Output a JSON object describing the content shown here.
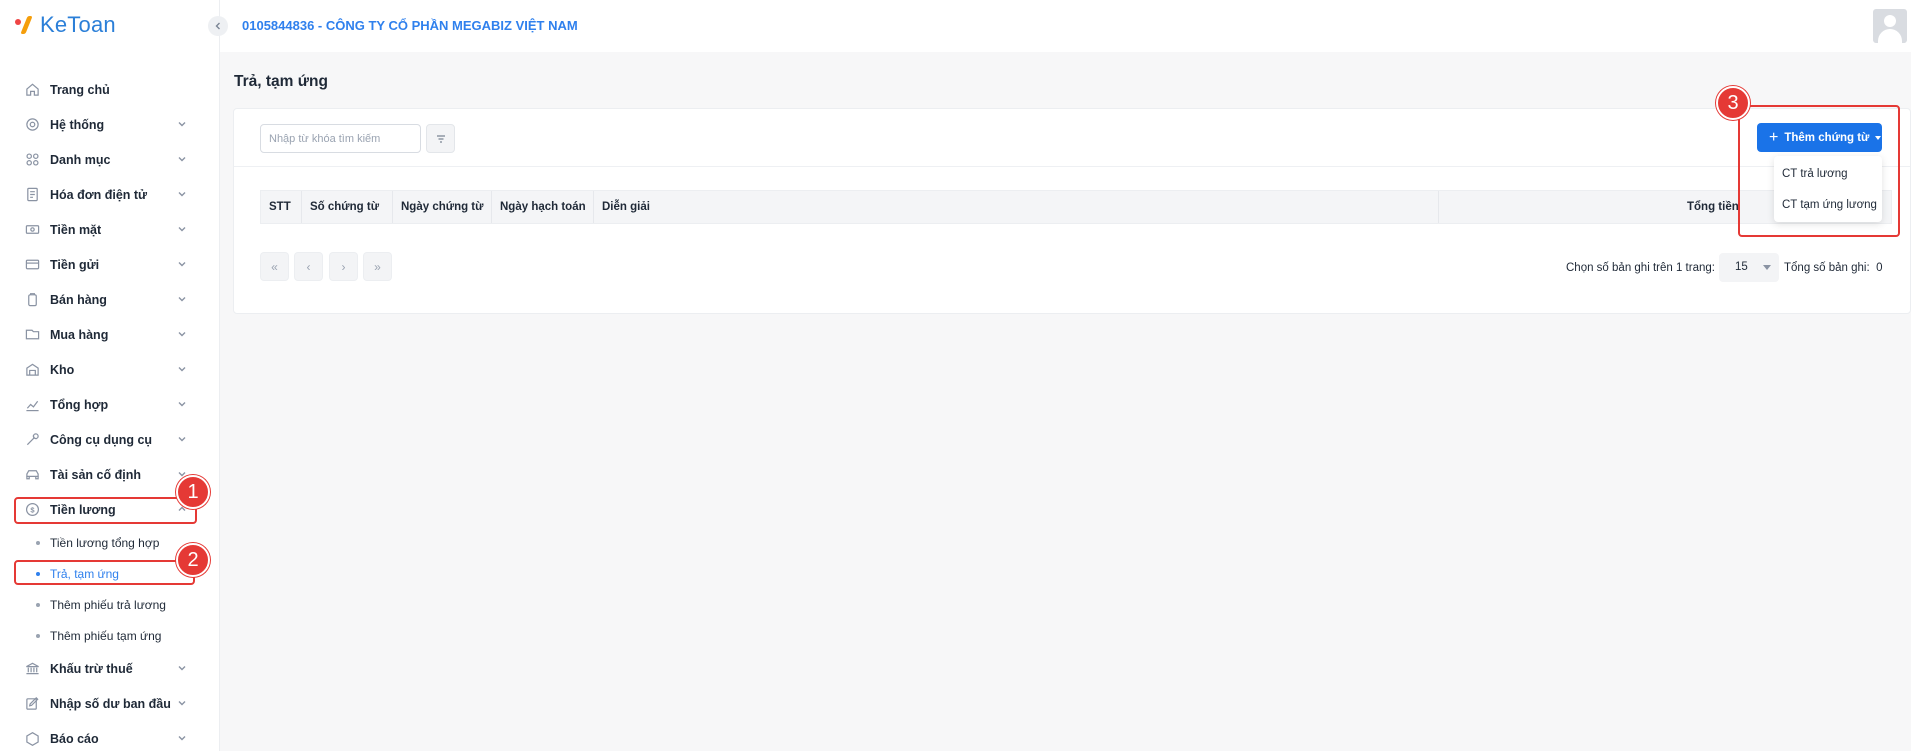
{
  "app": {
    "logo_text": "KeToan"
  },
  "header": {
    "company": "0105844836 - CÔNG TY CỔ PHẦN MEGABIZ VIỆT NAM"
  },
  "sidebar": {
    "items": [
      {
        "label": "Trang chủ",
        "icon": "home-icon"
      },
      {
        "label": "Hệ thống",
        "icon": "settings-icon"
      },
      {
        "label": "Danh mục",
        "icon": "grid-icon"
      },
      {
        "label": "Hóa đơn điện tử",
        "icon": "invoice-icon"
      },
      {
        "label": "Tiền mặt",
        "icon": "cash-icon"
      },
      {
        "label": "Tiền gửi",
        "icon": "card-icon"
      },
      {
        "label": "Bán hàng",
        "icon": "bag-icon"
      },
      {
        "label": "Mua hàng",
        "icon": "cart-icon"
      },
      {
        "label": "Kho",
        "icon": "warehouse-icon"
      },
      {
        "label": "Tổng hợp",
        "icon": "chart-icon"
      },
      {
        "label": "Công cụ dụng cụ",
        "icon": "tools-icon"
      },
      {
        "label": "Tài sản cố định",
        "icon": "car-icon"
      },
      {
        "label": "Tiền lương",
        "icon": "dollar-icon"
      },
      {
        "label": "Khấu trừ thuế",
        "icon": "bank-icon"
      },
      {
        "label": "Nhập số dư ban đầu",
        "icon": "edit-icon"
      },
      {
        "label": "Báo cáo",
        "icon": "report-icon"
      }
    ],
    "salary_sub": [
      {
        "label": "Tiền lương tổng hợp"
      },
      {
        "label": "Trả, tạm ứng"
      },
      {
        "label": "Thêm phiếu trả lương"
      },
      {
        "label": "Thêm phiếu tạm ứng"
      }
    ]
  },
  "page": {
    "title": "Trả, tạm ứng"
  },
  "search": {
    "placeholder": "Nhập từ khóa tìm kiếm"
  },
  "table": {
    "columns": [
      "STT",
      "Số chứng từ",
      "Ngày chứng từ",
      "Ngày hạch toán",
      "Diễn giải",
      "Tổng tiền"
    ]
  },
  "pagination": {
    "per_page_label": "Chọn số bản ghi trên 1 trang:",
    "per_page_value": "15",
    "total_label": "Tổng số bản ghi:",
    "total_value": "0"
  },
  "add_menu": {
    "button_label": "Thêm chứng từ",
    "options": [
      "CT trả lương",
      "CT tạm ứng lương"
    ]
  },
  "annotations": {
    "step1": "1",
    "step2": "2",
    "step3": "3"
  },
  "colors": {
    "accent": "#1a73e8",
    "link": "#2f80ed",
    "annotation": "#e53935"
  }
}
